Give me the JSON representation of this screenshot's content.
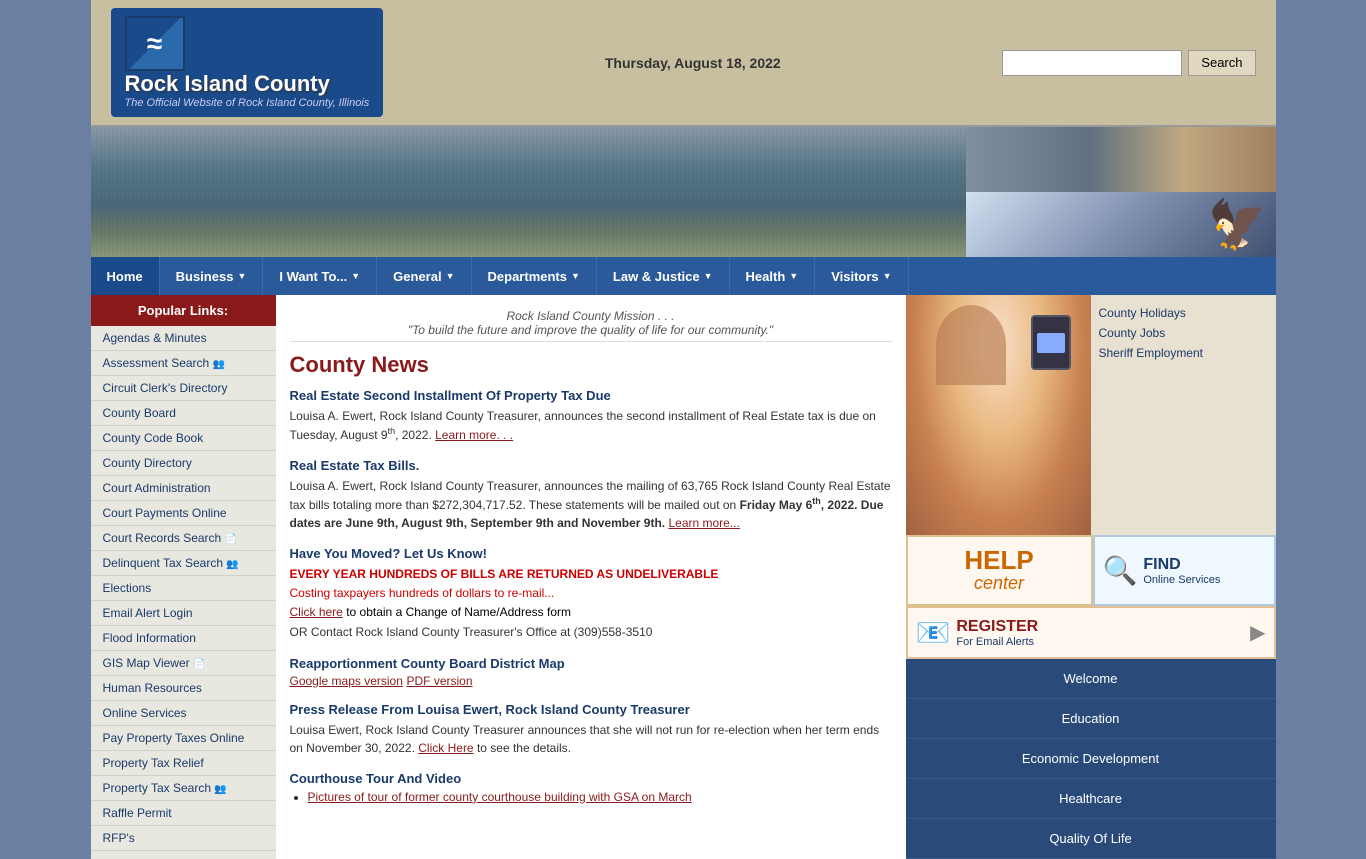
{
  "header": {
    "logo_line1": "Rock Island County",
    "logo_subtitle": "The Official Website of Rock Island County, Illinois",
    "date": "Thursday, August 18, 2022",
    "search_placeholder": "",
    "search_button": "Search"
  },
  "nav": {
    "items": [
      {
        "label": "Home",
        "has_arrow": false
      },
      {
        "label": "Business",
        "has_arrow": true
      },
      {
        "label": "I Want To...",
        "has_arrow": true
      },
      {
        "label": "General",
        "has_arrow": true
      },
      {
        "label": "Departments",
        "has_arrow": true
      },
      {
        "label": "Law & Justice",
        "has_arrow": true
      },
      {
        "label": "Health",
        "has_arrow": true
      },
      {
        "label": "Visitors",
        "has_arrow": true
      }
    ]
  },
  "sidebar": {
    "title": "Popular Links:",
    "items": [
      {
        "label": "Agendas & Minutes",
        "icon": ""
      },
      {
        "label": "Assessment Search",
        "icon": "👥"
      },
      {
        "label": "Circuit Clerk's Directory",
        "icon": ""
      },
      {
        "label": "County Board",
        "icon": ""
      },
      {
        "label": "County Code Book",
        "icon": ""
      },
      {
        "label": "County Directory",
        "icon": ""
      },
      {
        "label": "Court Administration",
        "icon": ""
      },
      {
        "label": "Court Payments Online",
        "icon": ""
      },
      {
        "label": "Court Records Search",
        "icon": "📄"
      },
      {
        "label": "Delinquent Tax Search",
        "icon": "👥"
      },
      {
        "label": "Elections",
        "icon": ""
      },
      {
        "label": "Email Alert Login",
        "icon": ""
      },
      {
        "label": "Flood Information",
        "icon": ""
      },
      {
        "label": "GIS Map Viewer",
        "icon": "📄"
      },
      {
        "label": "Human Resources",
        "icon": ""
      },
      {
        "label": "Online Services",
        "icon": ""
      },
      {
        "label": "Pay Property Taxes Online",
        "icon": ""
      },
      {
        "label": "Property Tax Relief",
        "icon": ""
      },
      {
        "label": "Property Tax Search",
        "icon": "👥"
      },
      {
        "label": "Raffle Permit",
        "icon": ""
      },
      {
        "label": "RFP's",
        "icon": ""
      }
    ]
  },
  "mission": {
    "line1": "Rock Island County Mission . . .",
    "line2": "\"To build the future and improve the quality of life for our community.\""
  },
  "news": {
    "title": "County News",
    "items": [
      {
        "title": "Real Estate Second Installment Of Property Tax Due",
        "body": "Louisa A. Ewert, Rock Island County Treasurer, announces the second installment of Real Estate tax is due on Tuesday,  August 9th, 2022.",
        "link": "Learn more. . ."
      },
      {
        "title": "Real Estate Tax Bills.",
        "body": "Louisa A. Ewert, Rock Island County Treasurer, announces the mailing of 63,765 Rock Island County Real Estate tax bills totaling more than $272,304,717.52. These statements will be mailed out on Friday May 6th, 2022.  Due dates are June 9th, August 9th, September 9th and November 9th.",
        "link": "Learn more..."
      }
    ],
    "moved": {
      "title": "Have You Moved? Let Us Know!",
      "alert1": "EVERY YEAR HUNDREDS OF BILLS ARE RETURNED AS UNDELIVERABLE",
      "alert2": "Costing taxpayers hundreds of dollars to re-mail...",
      "click_text": "Click here",
      "click_desc": " to obtain a Change of Name/Address form",
      "contact": "OR Contact Rock Island County Treasurer's Office at (309)558-3510"
    },
    "reapp": {
      "title": "Reapportionment County Board District Map",
      "link1": "Google maps version",
      "link2": "PDF version"
    },
    "press": {
      "title": "Press Release From Louisa Ewert, Rock Island County Treasurer",
      "body": "Louisa Ewert, Rock Island County Treasurer announces that she will not run for re-election when her term ends on November 30, 2022.",
      "link": "Click Here",
      "link_desc": " to see the details."
    },
    "tour": {
      "title": "Courthouse Tour And Video",
      "bullet": "Pictures of tour of former county courthouse building with GSA on March"
    }
  },
  "right_col": {
    "quick_links": [
      "County Holidays",
      "County Jobs",
      "Sheriff Employment"
    ]
  },
  "far_right": {
    "help": {
      "title": "HELP",
      "sub": "center"
    },
    "find": {
      "title": "FIND",
      "sub": "Online Services"
    },
    "register": {
      "title": "REGISTER",
      "sub": "For Email Alerts"
    }
  },
  "welcome_panels": [
    "Welcome",
    "Education",
    "Economic Development",
    "Healthcare",
    "Quality Of Life"
  ]
}
